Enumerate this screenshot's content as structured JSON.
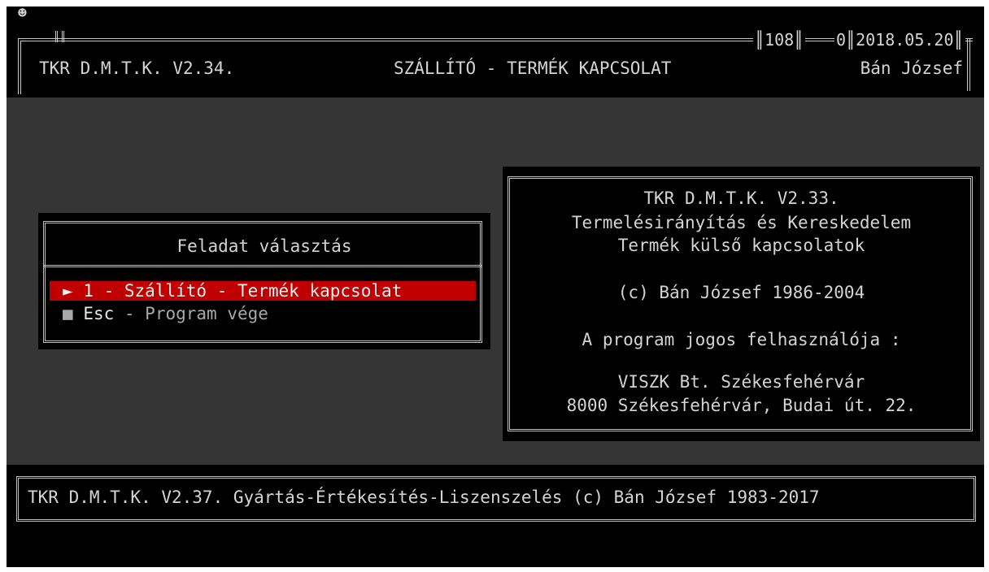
{
  "header": {
    "app_version": "TKR D.M.T.K. V2.34.",
    "title": "SZÁLLÍTÓ - TERMÉK KAPCSOLAT",
    "counter_a": "108",
    "counter_b": "0",
    "date": "2018.05.20",
    "user": "Bán József"
  },
  "menu": {
    "title": "Feladat választás",
    "items": [
      {
        "marker": "►",
        "key": "1",
        "label": " - Szállító - Termék kapcsolat"
      },
      {
        "marker": "■",
        "key": "Esc",
        "label": " - Program vége"
      }
    ]
  },
  "info": {
    "lines": [
      "TKR D.M.T.K. V2.33.",
      "Termelésirányítás és Kereskedelem",
      "Termék külső kapcsolatok",
      "(c) Bán József 1986-2004",
      "A program jogos felhasználója :",
      "VISZK Bt. Székesfehérvár",
      "8000 Székesfehérvár, Budai út. 22."
    ]
  },
  "footer": {
    "text": "TKR D.M.T.K. V2.37. Gyártás-Értékesítés-Liszenszelés (c) Bán József 1983-2017"
  },
  "icons": {
    "corner_icon": "smiley-icon"
  },
  "colors": {
    "selection": "#c00000",
    "background_main": "#353535",
    "panel": "#000000"
  }
}
